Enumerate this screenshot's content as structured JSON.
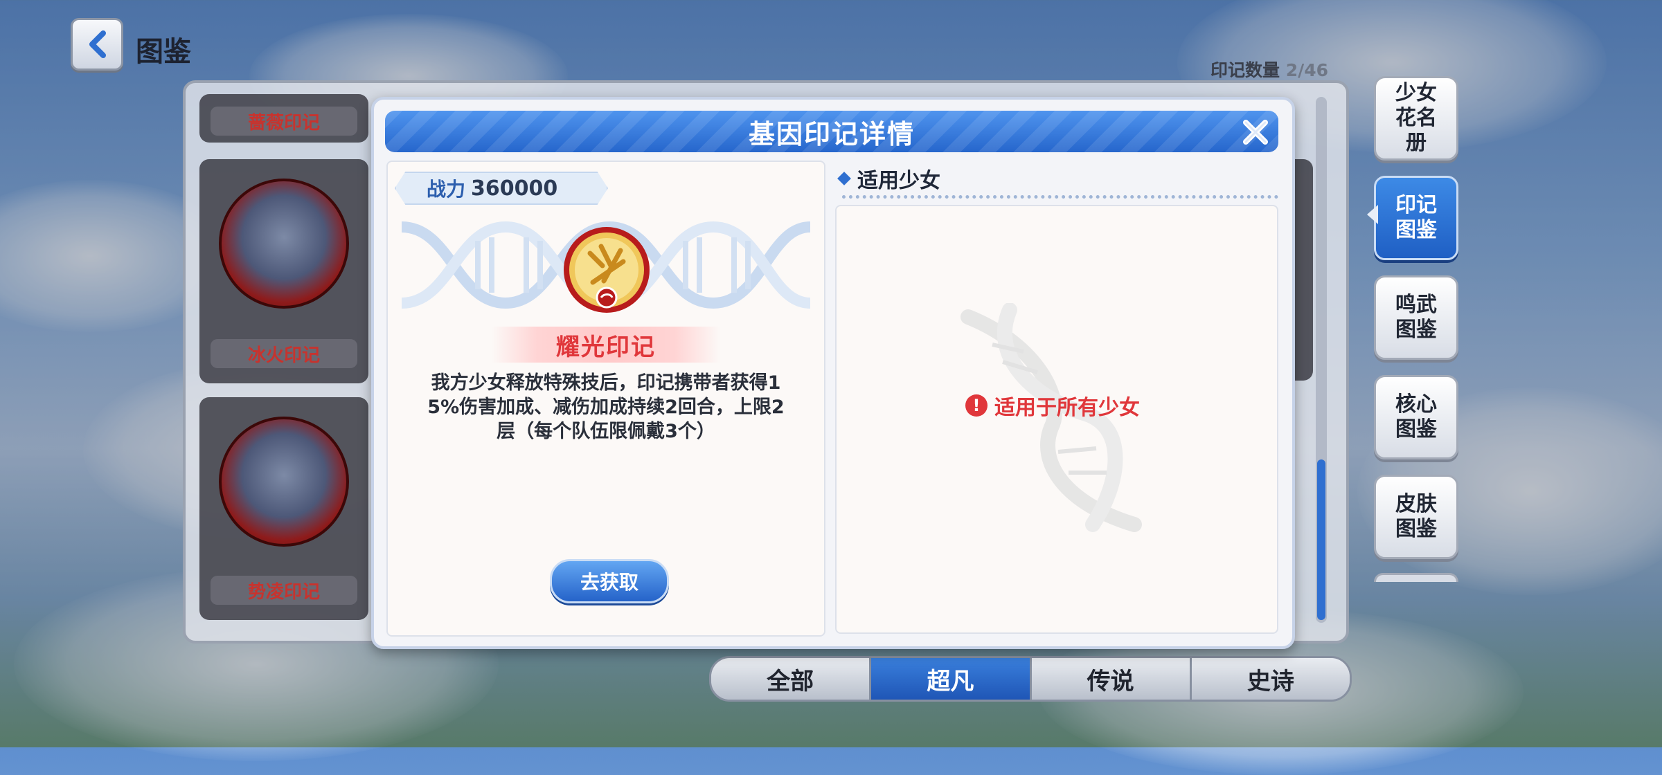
{
  "header": {
    "title": "图鉴",
    "mark_count_label": "印记数量",
    "mark_count_value": "2/46"
  },
  "list": {
    "cards": [
      {
        "name": "蔷薇印记"
      },
      {
        "name": "冰火印记"
      },
      {
        "name": "势凌印记"
      }
    ]
  },
  "side_menu": {
    "items": [
      {
        "label": "少女花名册",
        "active": false
      },
      {
        "label": "印记图鉴",
        "active": true
      },
      {
        "label": "鸣武图鉴",
        "active": false
      },
      {
        "label": "核心图鉴",
        "active": false
      },
      {
        "label": "皮肤图鉴",
        "active": false
      }
    ]
  },
  "tabs": [
    {
      "label": "全部",
      "active": false
    },
    {
      "label": "超凡",
      "active": true
    },
    {
      "label": "传说",
      "active": false
    },
    {
      "label": "史诗",
      "active": false
    }
  ],
  "modal": {
    "title": "基因印记详情",
    "power_label": "战力",
    "power_value": "360000",
    "mark_name": "耀光印记",
    "description_lines": [
      "我方少女释放特殊技后，印记携带者获得1",
      "5%伤害加成、减伤加成持续2回合，上限2",
      "层（每个队伍限佩戴3个）"
    ],
    "obtain_button": "去获取",
    "applicable_title": "适用少女",
    "applicable_message": "适用于所有少女"
  },
  "colors": {
    "accent_blue": "#2666cc",
    "mark_red": "#e0373b"
  }
}
